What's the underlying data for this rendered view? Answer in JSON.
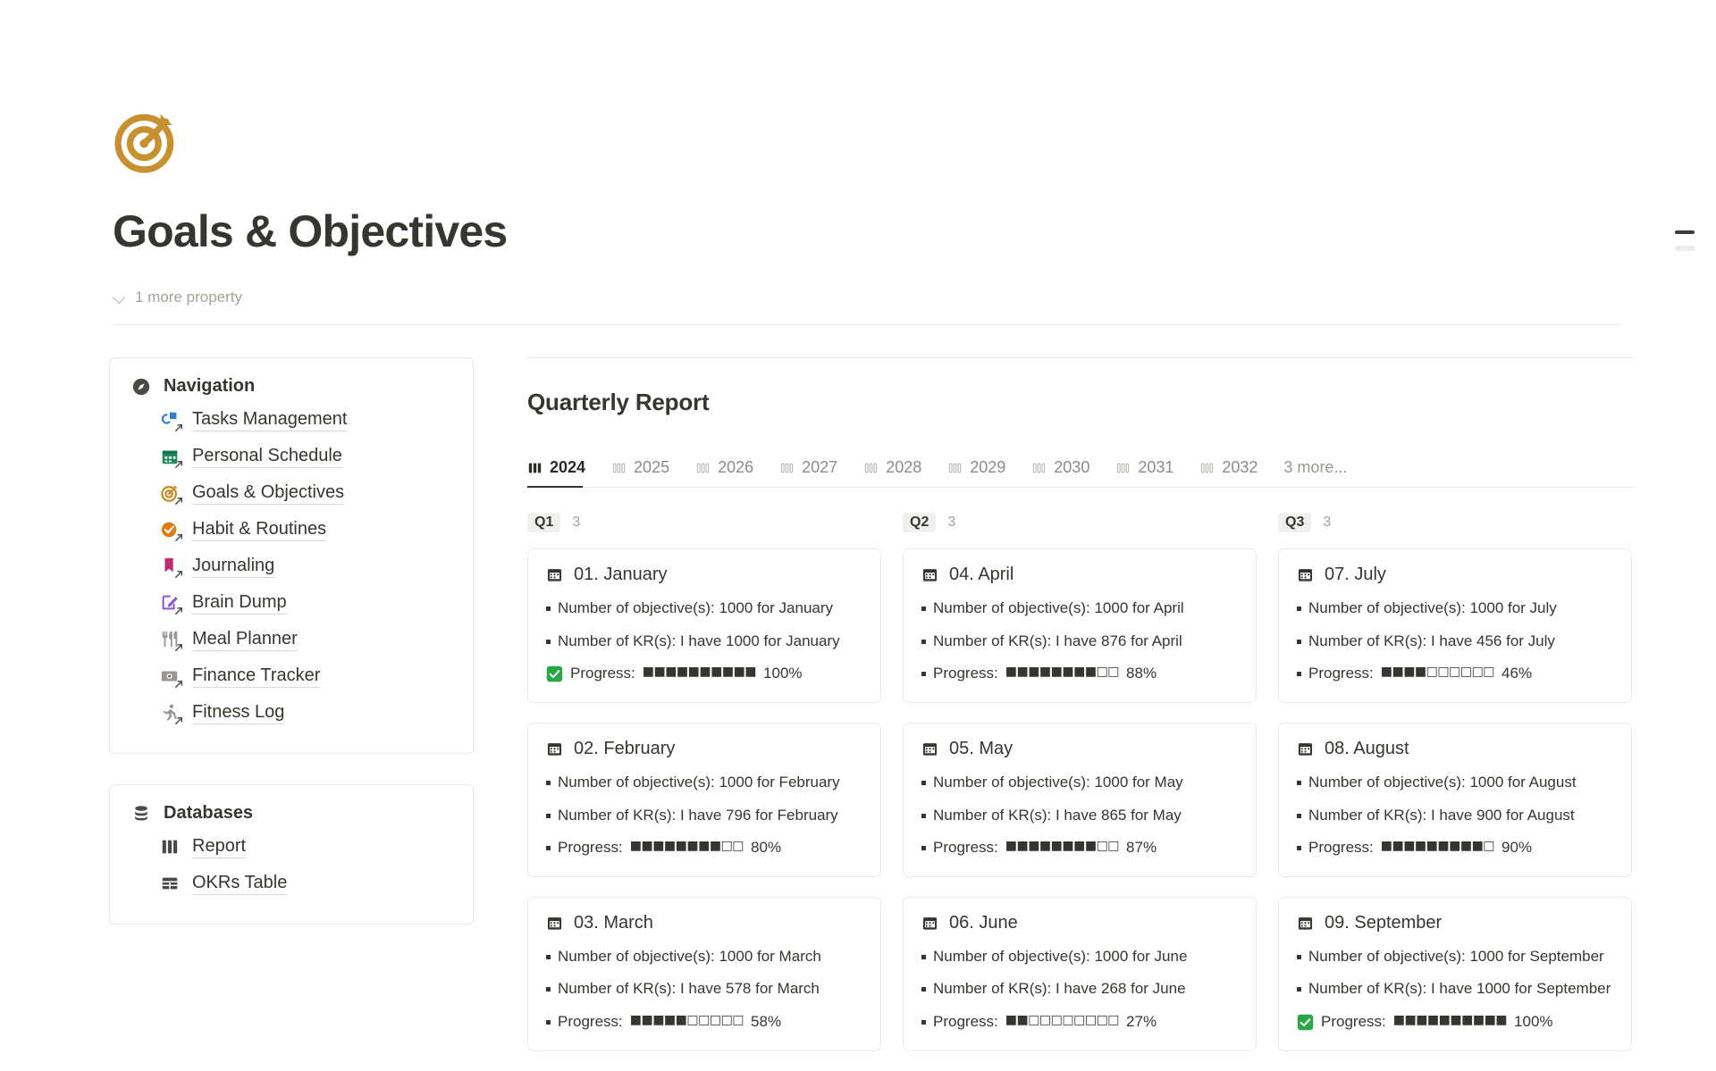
{
  "header": {
    "emoji_icon": "target-dart-icon",
    "title": "Goals & Objectives",
    "more_property_label": "1 more property",
    "accent_color": "#C8902F"
  },
  "sidebar": {
    "navigation": {
      "icon": "compass-icon",
      "label": "Navigation",
      "items": [
        {
          "icon": "tasks-icon",
          "label": "Tasks Management"
        },
        {
          "icon": "calendar-icon",
          "label": "Personal Schedule"
        },
        {
          "icon": "target-icon",
          "label": "Goals & Objectives"
        },
        {
          "icon": "check-circle-icon",
          "label": "Habit & Routines"
        },
        {
          "icon": "bookmark-icon",
          "label": "Journaling"
        },
        {
          "icon": "pencil-square-icon",
          "label": "Brain Dump"
        },
        {
          "icon": "fork-knife-icon",
          "label": "Meal Planner"
        },
        {
          "icon": "money-icon",
          "label": "Finance Tracker"
        },
        {
          "icon": "runner-icon",
          "label": "Fitness Log"
        }
      ]
    },
    "databases": {
      "icon": "database-icon",
      "label": "Databases",
      "items": [
        {
          "icon": "board-icon",
          "label": "Report"
        },
        {
          "icon": "table-icon",
          "label": "OKRs Table"
        }
      ]
    }
  },
  "main": {
    "report_title": "Quarterly Report",
    "year_tabs": [
      {
        "label": "2024",
        "icon": "board-icon",
        "active": true
      },
      {
        "label": "2025",
        "icon": "board-icon",
        "active": false
      },
      {
        "label": "2026",
        "icon": "board-icon",
        "active": false
      },
      {
        "label": "2027",
        "icon": "board-icon",
        "active": false
      },
      {
        "label": "2028",
        "icon": "board-icon",
        "active": false
      },
      {
        "label": "2029",
        "icon": "board-icon",
        "active": false
      },
      {
        "label": "2030",
        "icon": "board-icon",
        "active": false
      },
      {
        "label": "2031",
        "icon": "board-icon",
        "active": false
      },
      {
        "label": "2032",
        "icon": "board-icon",
        "active": false
      }
    ],
    "more_tabs_label": "3 more...",
    "quarters": [
      {
        "name": "Q1",
        "count": "3",
        "cards": [
          {
            "icon": "calendar-icon",
            "title": "01. January",
            "objectives": "Number of objective(s): 1000 for January",
            "krs": "Number of KR(s): I have 1000 for January",
            "progress_label": "Progress:",
            "progress_bar": "■■■■■■■■■■",
            "progress_pct": "100%",
            "complete": true
          },
          {
            "icon": "calendar-icon",
            "title": "02. February",
            "objectives": "Number of objective(s): 1000 for February",
            "krs": "Number of KR(s): I have 796 for February",
            "progress_label": "Progress:",
            "progress_bar": "■■■■■■■■□□",
            "progress_pct": "80%",
            "complete": false
          },
          {
            "icon": "calendar-icon",
            "title": "03. March",
            "objectives": "Number of objective(s): 1000 for March",
            "krs": "Number of KR(s): I have 578 for March",
            "progress_label": "Progress:",
            "progress_bar": "■■■■■□□□□□",
            "progress_pct": "58%",
            "complete": false
          }
        ]
      },
      {
        "name": "Q2",
        "count": "3",
        "cards": [
          {
            "icon": "calendar-icon",
            "title": "04. April",
            "objectives": "Number of objective(s): 1000 for April",
            "krs": "Number of KR(s): I have 876 for April",
            "progress_label": "Progress:",
            "progress_bar": "■■■■■■■■□□",
            "progress_pct": "88%",
            "complete": false
          },
          {
            "icon": "calendar-icon",
            "title": "05. May",
            "objectives": "Number of objective(s): 1000 for May",
            "krs": "Number of KR(s): I have 865 for May",
            "progress_label": "Progress:",
            "progress_bar": "■■■■■■■■□□",
            "progress_pct": "87%",
            "complete": false
          },
          {
            "icon": "calendar-icon",
            "title": "06. June",
            "objectives": "Number of objective(s): 1000 for June",
            "krs": "Number of KR(s): I have 268 for June",
            "progress_label": "Progress:",
            "progress_bar": "■■□□□□□□□□",
            "progress_pct": "27%",
            "complete": false
          }
        ]
      },
      {
        "name": "Q3",
        "count": "3",
        "cards": [
          {
            "icon": "calendar-icon",
            "title": "07. July",
            "objectives": "Number of objective(s): 1000 for July",
            "krs": "Number of KR(s): I have 456 for July",
            "progress_label": "Progress:",
            "progress_bar": "■■■■□□□□□□",
            "progress_pct": "46%",
            "complete": false
          },
          {
            "icon": "calendar-icon",
            "title": "08. August",
            "objectives": "Number of objective(s): 1000 for August",
            "krs": "Number of KR(s): I have 900 for August",
            "progress_label": "Progress:",
            "progress_bar": "■■■■■■■■■□",
            "progress_pct": "90%",
            "complete": false
          },
          {
            "icon": "calendar-icon",
            "title": "09. September",
            "objectives": "Number of objective(s): 1000 for September",
            "krs": "Number of KR(s): I have 1000 for September",
            "progress_label": "Progress:",
            "progress_bar": "■■■■■■■■■■",
            "progress_pct": "100%",
            "complete": true
          }
        ]
      }
    ]
  }
}
